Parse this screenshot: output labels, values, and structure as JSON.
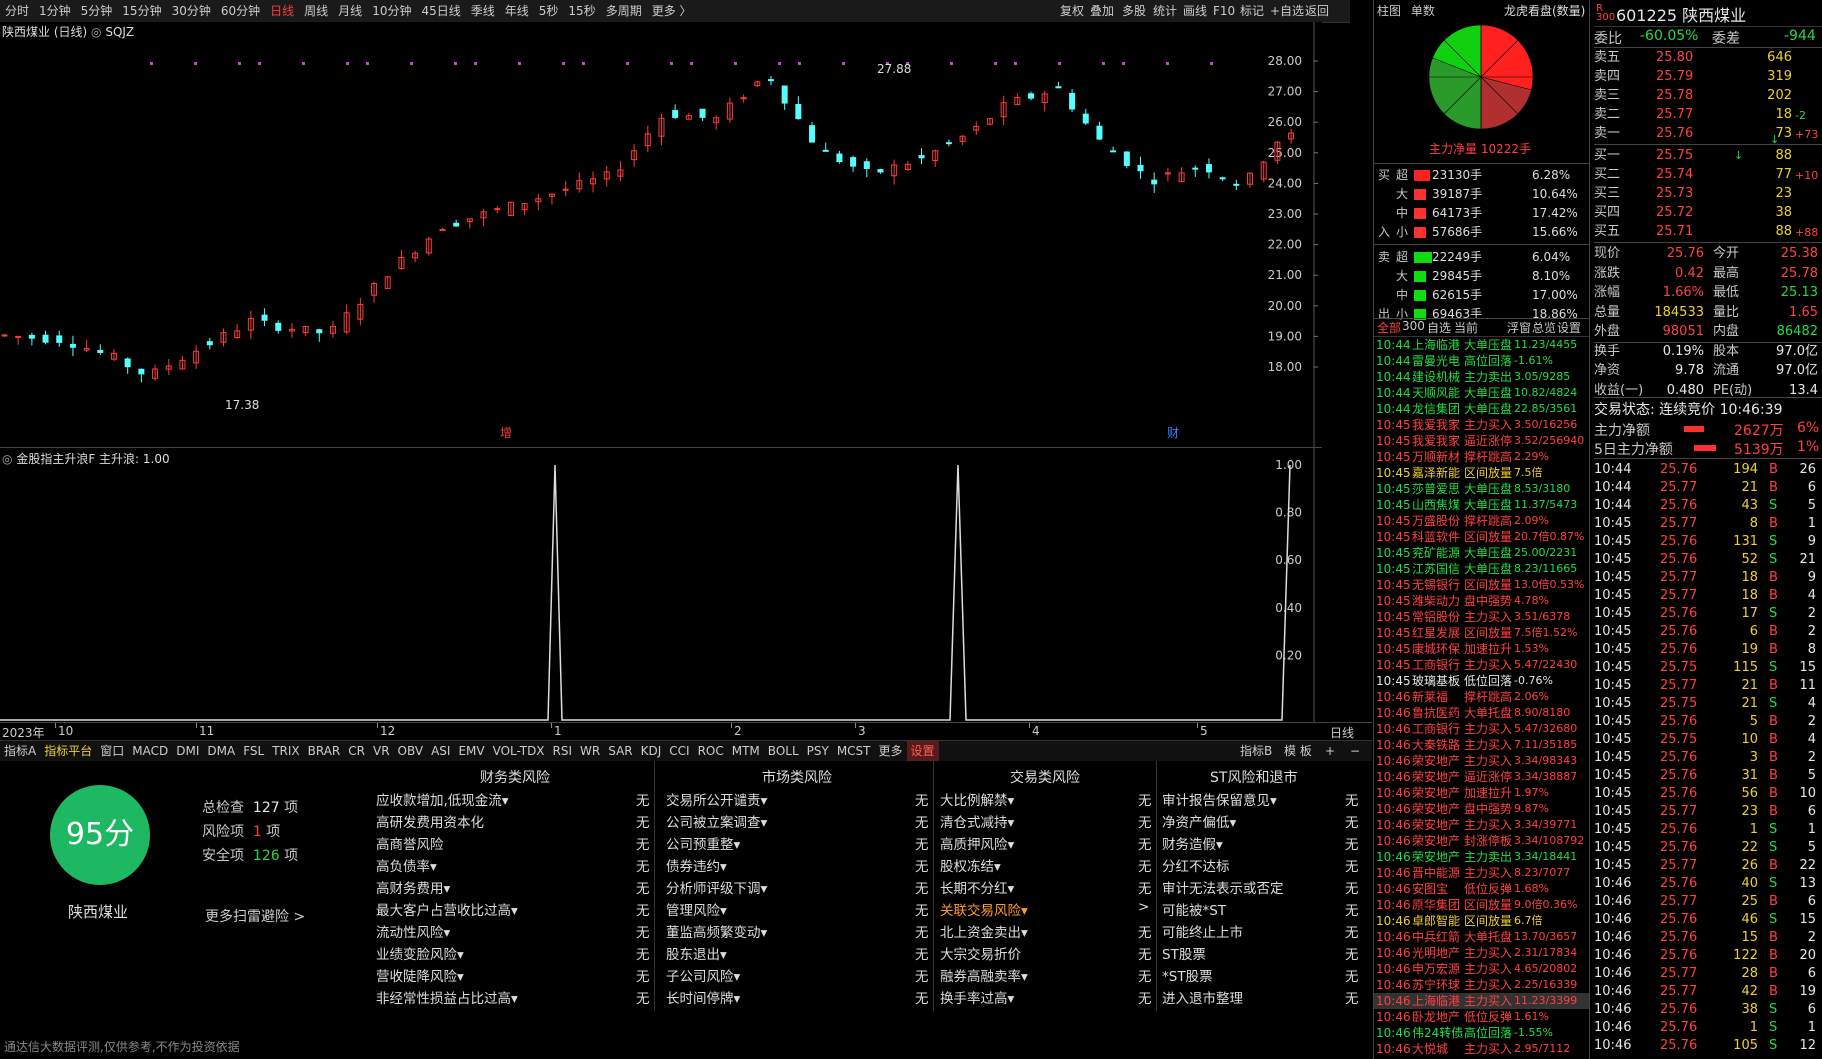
{
  "topbar": {
    "periods": [
      "分时",
      "1分钟",
      "5分钟",
      "15分钟",
      "30分钟",
      "60分钟",
      "日线",
      "周线",
      "月线",
      "10分钟",
      "45日线",
      "季线",
      "年线",
      "5秒",
      "15秒",
      "多周期",
      "更多 〉"
    ],
    "active": "日线",
    "tools": [
      "复权",
      "叠加",
      "多股",
      "统计",
      "画线",
      "F10",
      "标记",
      "+自选",
      "返回"
    ]
  },
  "chart": {
    "title": "陕西煤业 (日线)",
    "formula": "SQJZ",
    "high_label": "27.88",
    "low_label": "17.38",
    "marker_zeng": "增",
    "marker_cai": "财",
    "yticks": [
      "28.00",
      "27.00",
      "26.00",
      "25.00",
      "24.00",
      "23.00",
      "22.00",
      "21.00",
      "20.00",
      "19.00",
      "18.00"
    ]
  },
  "indicator": {
    "title": "金股指主升浪F  主升浪: 1.00",
    "yticks": [
      "1.00",
      "0.80",
      "0.60",
      "0.40",
      "0.20"
    ]
  },
  "xaxis": {
    "labels": [
      "2023年",
      "10",
      "11",
      "12",
      "1",
      "2",
      "3",
      "4",
      "5"
    ],
    "period": "日线"
  },
  "tabs": {
    "items": [
      "指标A",
      "指标平台",
      "窗口",
      "MACD",
      "DMI",
      "DMA",
      "FSL",
      "TRIX",
      "BRAR",
      "CR",
      "VR",
      "OBV",
      "ASI",
      "EMV",
      "VOL-TDX",
      "RSI",
      "WR",
      "SAR",
      "KDJ",
      "CCI",
      "ROC",
      "MTM",
      "BOLL",
      "PSY",
      "MCST",
      "更多",
      "设置"
    ],
    "right": [
      "指标B",
      "模 板",
      "+",
      "−"
    ]
  },
  "risk": {
    "score": "95分",
    "stock_name": "陕西煤业",
    "total_label": "总检查",
    "total_value": "127",
    "total_unit": "项",
    "risk_label": "风险项",
    "risk_value": "1",
    "risk_unit": "项",
    "safe_label": "安全项",
    "safe_value": "126",
    "safe_unit": "项",
    "more": "更多扫雷避险 >",
    "footer": "通达信大数据评测,仅供参考,不作为投资依据",
    "columns": [
      {
        "title": "财务类风险",
        "items": [
          [
            "应收款增加,低现金流▾",
            "无"
          ],
          [
            "高研发费用资本化",
            "无"
          ],
          [
            "高商誉风险",
            "无"
          ],
          [
            "高负债率▾",
            "无"
          ],
          [
            "高财务费用▾",
            "无"
          ],
          [
            "最大客户占营收比过高▾",
            "无"
          ],
          [
            "流动性风险▾",
            "无"
          ],
          [
            "业绩变脸风险▾",
            "无"
          ],
          [
            "营收陡降风险▾",
            "无"
          ],
          [
            "非经常性损益占比过高▾",
            "无"
          ]
        ]
      },
      {
        "title": "市场类风险",
        "items": [
          [
            "交易所公开谴责▾",
            "无"
          ],
          [
            "公司被立案调查▾",
            "无"
          ],
          [
            "公司预重整▾",
            "无"
          ],
          [
            "债券违约▾",
            "无"
          ],
          [
            "分析师评级下调▾",
            "无"
          ],
          [
            "管理风险▾",
            "无"
          ],
          [
            "董监高频繁变动▾",
            "无"
          ],
          [
            "股东退出▾",
            "无"
          ],
          [
            "子公司风险▾",
            "无"
          ],
          [
            "长时间停牌▾",
            "无"
          ]
        ]
      },
      {
        "title": "交易类风险",
        "items": [
          [
            "大比例解禁▾",
            "无"
          ],
          [
            "清仓式减持▾",
            "无"
          ],
          [
            "高质押风险▾",
            "无"
          ],
          [
            "股权冻结▾",
            "无"
          ],
          [
            "长期不分红▾",
            "无"
          ],
          [
            "关联交易风险▾",
            ">"
          ],
          [
            "北上资金卖出▾",
            "无"
          ],
          [
            "大宗交易折价",
            "无"
          ],
          [
            "融券高融卖率▾",
            "无"
          ],
          [
            "换手率过高▾",
            "无"
          ]
        ]
      },
      {
        "title": "ST风险和退市",
        "items": [
          [
            "审计报告保留意见▾",
            "无"
          ],
          [
            "净资产偏低▾",
            "无"
          ],
          [
            "财务造假▾",
            "无"
          ],
          [
            "分红不达标",
            "无"
          ],
          [
            "审计无法表示或否定",
            "无"
          ],
          [
            "可能被*ST",
            "无"
          ],
          [
            "可能终止上市",
            "无"
          ],
          [
            "ST股票",
            "无"
          ],
          [
            "*ST股票",
            "无"
          ],
          [
            "进入退市整理",
            "无"
          ]
        ]
      }
    ]
  },
  "panel_mid": {
    "tabs": [
      "柱图",
      "单数"
    ],
    "title": "龙虎看盘(数量)",
    "net_label": "主力净量 10222手",
    "buy_side_label": [
      "买",
      "入"
    ],
    "sell_side_label": [
      "卖",
      "出"
    ],
    "flows": [
      [
        "超",
        "23130手",
        "6.28%"
      ],
      [
        "大",
        "39187手",
        "10.64%"
      ],
      [
        "中",
        "64173手",
        "17.42%"
      ],
      [
        "小",
        "57686手",
        "15.66%"
      ],
      [
        "超",
        "22249手",
        "6.04%"
      ],
      [
        "大",
        "29845手",
        "8.10%"
      ],
      [
        "中",
        "62615手",
        "17.00%"
      ],
      [
        "小",
        "69463手",
        "18.86%"
      ]
    ],
    "filter": [
      "全部",
      "300",
      "自选",
      "当前"
    ],
    "filter_right": [
      "浮窗",
      "总览",
      "设置"
    ],
    "news": [
      [
        "10:44",
        "上海临港",
        "大单压盘",
        "11.23/4455",
        "g"
      ],
      [
        "10:44",
        "雷曼光电",
        "高位回落",
        "-1.61%",
        "g"
      ],
      [
        "10:44",
        "建设机械",
        "主力卖出",
        "3.05/9285",
        "g"
      ],
      [
        "10:44",
        "天顺风能",
        "大单压盘",
        "10.82/4824",
        "g"
      ],
      [
        "10:44",
        "龙信集团",
        "大单压盘",
        "22.85/3561",
        "g"
      ],
      [
        "10:45",
        "我爱我家",
        "主力买入",
        "3.50/16256",
        "r"
      ],
      [
        "10:45",
        "我爱我家",
        "逼近涨停",
        "3.52/256940",
        "r"
      ],
      [
        "10:45",
        "万顺新材",
        "撑杆跳高",
        "2.29%",
        "r"
      ],
      [
        "10:45",
        "嘉泽新能",
        "区间放量",
        "7.5倍",
        "y"
      ],
      [
        "10:45",
        "莎普爱思",
        "大单压盘",
        "8.53/3180",
        "g"
      ],
      [
        "10:45",
        "山西焦煤",
        "大单压盘",
        "11.37/5473",
        "g"
      ],
      [
        "10:45",
        "万盛股份",
        "撑杆跳高",
        "2.09%",
        "r"
      ],
      [
        "10:45",
        "科蓝软件",
        "区间放量",
        "20.7倍0.87%",
        "r"
      ],
      [
        "10:45",
        "兖矿能源",
        "大单压盘",
        "25.00/2231",
        "g"
      ],
      [
        "10:45",
        "江苏国信",
        "大单压盘",
        "8.23/11665",
        "g"
      ],
      [
        "10:45",
        "无锡银行",
        "区间放量",
        "13.0倍0.53%",
        "r"
      ],
      [
        "10:45",
        "潍柴动力",
        "盘中强势",
        "4.78%",
        "r"
      ],
      [
        "10:45",
        "常铝股份",
        "主力买入",
        "3.51/6378",
        "r"
      ],
      [
        "10:45",
        "红星发展",
        "区间放量",
        "7.5倍1.52%",
        "r"
      ],
      [
        "10:45",
        "康城环保",
        "加速拉升",
        "1.53%",
        "r"
      ],
      [
        "10:45",
        "工商银行",
        "主力买入",
        "5.47/22430",
        "r"
      ],
      [
        "10:45",
        "玻璃基板",
        "低位回落",
        "-0.76%",
        "w"
      ],
      [
        "10:46",
        "新莱福",
        "撑杆跳高",
        "2.06%",
        "r"
      ],
      [
        "10:46",
        "鲁抗医药",
        "大单托盘",
        "8.90/8180",
        "r"
      ],
      [
        "10:46",
        "工商银行",
        "主力买入",
        "5.47/32680",
        "r"
      ],
      [
        "10:46",
        "大秦铁路",
        "主力买入",
        "7.11/35185",
        "r"
      ],
      [
        "10:46",
        "荣安地产",
        "主力买入",
        "3.34/98343",
        "r"
      ],
      [
        "10:46",
        "荣安地产",
        "逼近涨停",
        "3.34/38887",
        "r"
      ],
      [
        "10:46",
        "荣安地产",
        "加速拉升",
        "1.97%",
        "r"
      ],
      [
        "10:46",
        "荣安地产",
        "盘中强势",
        "9.87%",
        "r"
      ],
      [
        "10:46",
        "荣安地产",
        "主力买入",
        "3.34/39771",
        "r"
      ],
      [
        "10:46",
        "荣安地产",
        "封涨停板",
        "3.34/108792",
        "r"
      ],
      [
        "10:46",
        "荣安地产",
        "主力卖出",
        "3.34/18441",
        "g"
      ],
      [
        "10:46",
        "晋中能源",
        "主力买入",
        "8.23/7077",
        "r"
      ],
      [
        "10:46",
        "安图宝",
        "低位反弹",
        "1.68%",
        "r"
      ],
      [
        "10:46",
        "原华集团",
        "区间放量",
        "9.0倍0.36%",
        "r"
      ],
      [
        "10:46",
        "卓郎智能",
        "区间放量",
        "6.7倍",
        "y"
      ],
      [
        "10:46",
        "中兵红箭",
        "大单托盘",
        "13.70/3657",
        "r"
      ],
      [
        "10:46",
        "光明地产",
        "主力买入",
        "2.31/17834",
        "r"
      ],
      [
        "10:46",
        "申万宏源",
        "主力买入",
        "4.65/20802",
        "r"
      ],
      [
        "10:46",
        "苏宁环球",
        "主力买入",
        "2.25/16339",
        "r"
      ],
      [
        "10:46",
        "上海临港",
        "主力买入",
        "11.23/3399",
        "r"
      ],
      [
        "10:46",
        "卧龙地产",
        "低位反弹",
        "1.61%",
        "r"
      ],
      [
        "10:46",
        "伟24转债",
        "高位回落",
        "-1.55%",
        "g"
      ],
      [
        "10:46",
        "大悦城",
        "主力买入",
        "2.95/7112",
        "r"
      ]
    ]
  },
  "panel_right": {
    "code": "601225",
    "name": "陕西煤业",
    "weibi_label": "委比",
    "weibi": "-60.05%",
    "weicha_label": "委差",
    "weicha": "-944",
    "asks": [
      [
        "卖五",
        "25.80",
        "646",
        ""
      ],
      [
        "卖四",
        "25.79",
        "319",
        ""
      ],
      [
        "卖三",
        "25.78",
        "202",
        ""
      ],
      [
        "卖二",
        "25.77",
        "18",
        "-2"
      ],
      [
        "卖一",
        "25.76",
        "73",
        "+73"
      ]
    ],
    "bids": [
      [
        "买一",
        "25.75",
        "88",
        ""
      ],
      [
        "买二",
        "25.74",
        "77",
        "+10"
      ],
      [
        "买三",
        "25.73",
        "23",
        ""
      ],
      [
        "买四",
        "25.72",
        "38",
        ""
      ],
      [
        "买五",
        "25.71",
        "88",
        "+88"
      ]
    ],
    "stats": [
      [
        "现价",
        "25.76",
        "今开",
        "25.38"
      ],
      [
        "涨跌",
        "0.42",
        "最高",
        "25.78"
      ],
      [
        "涨幅",
        "1.66%",
        "最低",
        "25.13"
      ],
      [
        "总量",
        "184533",
        "量比",
        "1.65"
      ],
      [
        "外盘",
        "98051",
        "内盘",
        "86482"
      ],
      [
        "换手",
        "0.19%",
        "股本",
        "97.0亿"
      ],
      [
        "净资",
        "9.78",
        "流通",
        "97.0亿"
      ],
      [
        "收益(一)",
        "0.480",
        "PE(动)",
        "13.4"
      ]
    ],
    "status": "交易状态: 连续竞价 10:46:39",
    "main_net_label": "主力净额",
    "main_net": "2627万",
    "main_net_pct": "6%",
    "five_day_label": "5日主力净额",
    "five_day": "5139万",
    "five_day_pct": "1%",
    "ticks": [
      [
        "10:44",
        "25.76",
        "194",
        "B",
        "26"
      ],
      [
        "10:44",
        "25.77",
        "21",
        "B",
        "6"
      ],
      [
        "10:44",
        "25.76",
        "43",
        "S",
        "5"
      ],
      [
        "10:45",
        "25.77",
        "8",
        "B",
        "1"
      ],
      [
        "10:45",
        "25.76",
        "131",
        "S",
        "9"
      ],
      [
        "10:45",
        "25.76",
        "52",
        "S",
        "21"
      ],
      [
        "10:45",
        "25.77",
        "18",
        "B",
        "9"
      ],
      [
        "10:45",
        "25.77",
        "18",
        "B",
        "4"
      ],
      [
        "10:45",
        "25.76",
        "17",
        "S",
        "2"
      ],
      [
        "10:45",
        "25.76",
        "6",
        "B",
        "2"
      ],
      [
        "10:45",
        "25.76",
        "19",
        "B",
        "8"
      ],
      [
        "10:45",
        "25.75",
        "115",
        "S",
        "15"
      ],
      [
        "10:45",
        "25.77",
        "21",
        "B",
        "11"
      ],
      [
        "10:45",
        "25.75",
        "21",
        "S",
        "4"
      ],
      [
        "10:45",
        "25.76",
        "5",
        "B",
        "2"
      ],
      [
        "10:45",
        "25.75",
        "10",
        "B",
        "4"
      ],
      [
        "10:45",
        "25.76",
        "3",
        "B",
        "2"
      ],
      [
        "10:45",
        "25.76",
        "31",
        "B",
        "5"
      ],
      [
        "10:45",
        "25.76",
        "56",
        "B",
        "10"
      ],
      [
        "10:45",
        "25.77",
        "23",
        "B",
        "6"
      ],
      [
        "10:45",
        "25.76",
        "1",
        "S",
        "1"
      ],
      [
        "10:45",
        "25.76",
        "22",
        "S",
        "5"
      ],
      [
        "10:45",
        "25.77",
        "26",
        "B",
        "22"
      ],
      [
        "10:46",
        "25.76",
        "40",
        "S",
        "13"
      ],
      [
        "10:46",
        "25.77",
        "25",
        "B",
        "6"
      ],
      [
        "10:46",
        "25.76",
        "46",
        "S",
        "15"
      ],
      [
        "10:46",
        "25.76",
        "15",
        "B",
        "2"
      ],
      [
        "10:46",
        "25.76",
        "122",
        "B",
        "20"
      ],
      [
        "10:46",
        "25.77",
        "28",
        "B",
        "6"
      ],
      [
        "10:46",
        "25.77",
        "42",
        "B",
        "19"
      ],
      [
        "10:46",
        "25.76",
        "38",
        "S",
        "6"
      ],
      [
        "10:46",
        "25.76",
        "1",
        "S",
        "1"
      ],
      [
        "10:46",
        "25.76",
        "105",
        "S",
        "12"
      ]
    ]
  },
  "colors": {
    "up": "#ff3b3b",
    "down": "#54ffff",
    "pie1": "#ff2020",
    "pie2": "#b03030",
    "pie3": "#2a9a2a",
    "pie4": "#10d010"
  }
}
